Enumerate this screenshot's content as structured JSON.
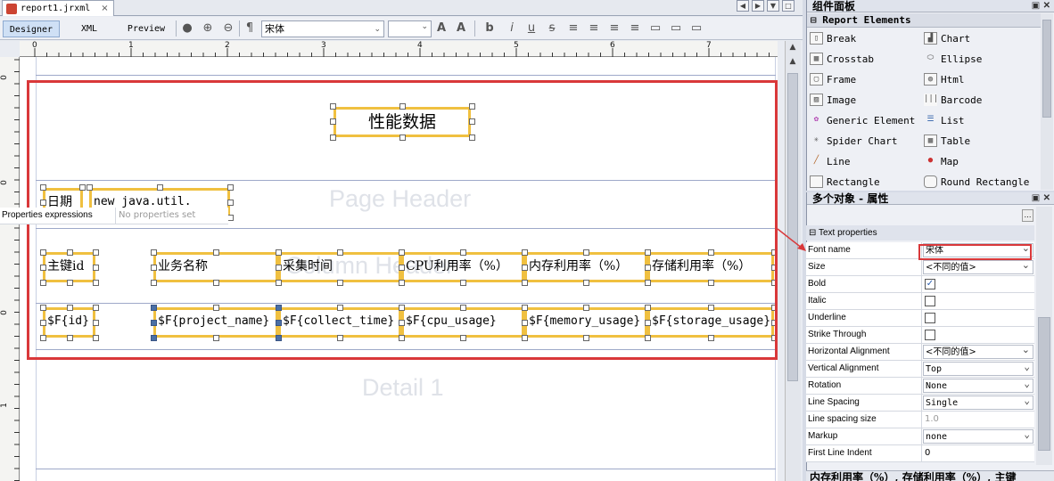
{
  "tab": {
    "title": "report1.jrxml",
    "close": "×"
  },
  "modes": {
    "designer": "Designer",
    "xml": "XML",
    "preview": "Preview"
  },
  "toolbar": {
    "font_name": "宋体",
    "font_size": ""
  },
  "ruler_h": [
    "0",
    "1",
    "2",
    "3",
    "4",
    "5",
    "6",
    "7"
  ],
  "ruler_v": [
    "0",
    "0",
    "0",
    "1"
  ],
  "bands": {
    "page_header": "Page Header",
    "column_header": "Column Header",
    "detail": "Detail 1"
  },
  "report": {
    "title": "性能数据",
    "date_label": "日期",
    "date_expr": "new java.util.",
    "columns": [
      "主键id",
      "业务名称",
      "采集时间",
      "CPU利用率（%）",
      "内存利用率（%）",
      "存储利用率（%）"
    ],
    "fields": [
      "$F{id}",
      "$F{project_name}",
      "$F{collect_time}",
      "$F{cpu_usage}",
      "$F{memory_usage}",
      "$F{storage_usage}"
    ]
  },
  "palette": {
    "title": "组件面板",
    "category": "Report Elements",
    "items": [
      "Break",
      "Chart",
      "Crosstab",
      "Ellipse",
      "Frame",
      "Html",
      "Image",
      "Barcode",
      "Generic Element",
      "List",
      "Spider Chart",
      "Table",
      "Line",
      "Map",
      "Rectangle",
      "Round Rectangle"
    ]
  },
  "properties": {
    "title": "多个对象 - 属性",
    "expr_label": "Properties expressions",
    "expr_value": "No properties set",
    "section": "Text properties",
    "rows": [
      {
        "name": "Font name",
        "value": "宋体"
      },
      {
        "name": "Size",
        "value": "<不同的值>"
      },
      {
        "name": "Bold",
        "value": ""
      },
      {
        "name": "Italic",
        "value": ""
      },
      {
        "name": "Underline",
        "value": ""
      },
      {
        "name": "Strike Through",
        "value": ""
      },
      {
        "name": "Horizontal Alignment",
        "value": "<不同的值>"
      },
      {
        "name": "Vertical Alignment",
        "value": "Top"
      },
      {
        "name": "Rotation",
        "value": "None"
      },
      {
        "name": "Line Spacing",
        "value": "Single"
      },
      {
        "name": "Line spacing size",
        "value": "1.0"
      },
      {
        "name": "Markup",
        "value": "none"
      },
      {
        "name": "First Line Indent",
        "value": "0"
      }
    ],
    "bottom": "内存利用率（%）, 存储利用率（%）, 主键"
  },
  "bold_checked": "✓"
}
